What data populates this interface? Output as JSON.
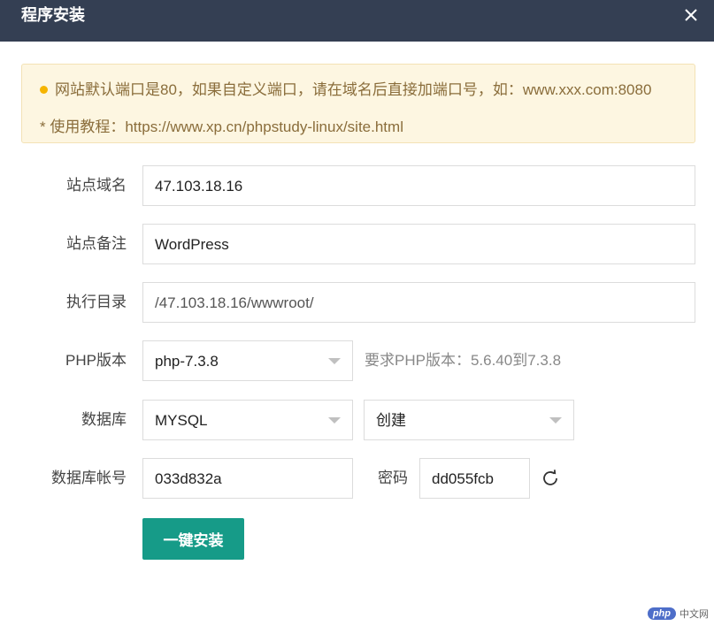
{
  "dialog": {
    "title": "程序安装",
    "close_icon": "close-icon"
  },
  "notice": {
    "line1": "网站默认端口是80，如果自定义端口，请在域名后直接加端口号，如：www.xxx.com:8080",
    "line2": "* 使用教程：https://www.xp.cn/phpstudy-linux/site.html",
    "dot_color": "#f5b400"
  },
  "form": {
    "domain_label": "站点域名",
    "domain_value": "47.103.18.16",
    "note_label": "站点备注",
    "note_value": "WordPress",
    "dir_label": "执行目录",
    "dir_value": "/47.103.18.16/wwwroot/",
    "php_label": "PHP版本",
    "php_value": "php-7.3.8",
    "php_hint": "要求PHP版本：5.6.40到7.3.8",
    "db_label": "数据库",
    "db_type_value": "MYSQL",
    "db_action_value": "创建",
    "db_account_label": "数据库帐号",
    "db_account_value": "033d832a",
    "password_label": "密码",
    "password_value": "dd055fcb",
    "refresh_icon": "refresh-icon"
  },
  "install_button": "一键安装",
  "colors": {
    "titlebar": "#343f53",
    "accent": "#169b88",
    "notice_bg": "#fdf6e1"
  },
  "watermark": {
    "logo": "php",
    "text": "中文网"
  }
}
